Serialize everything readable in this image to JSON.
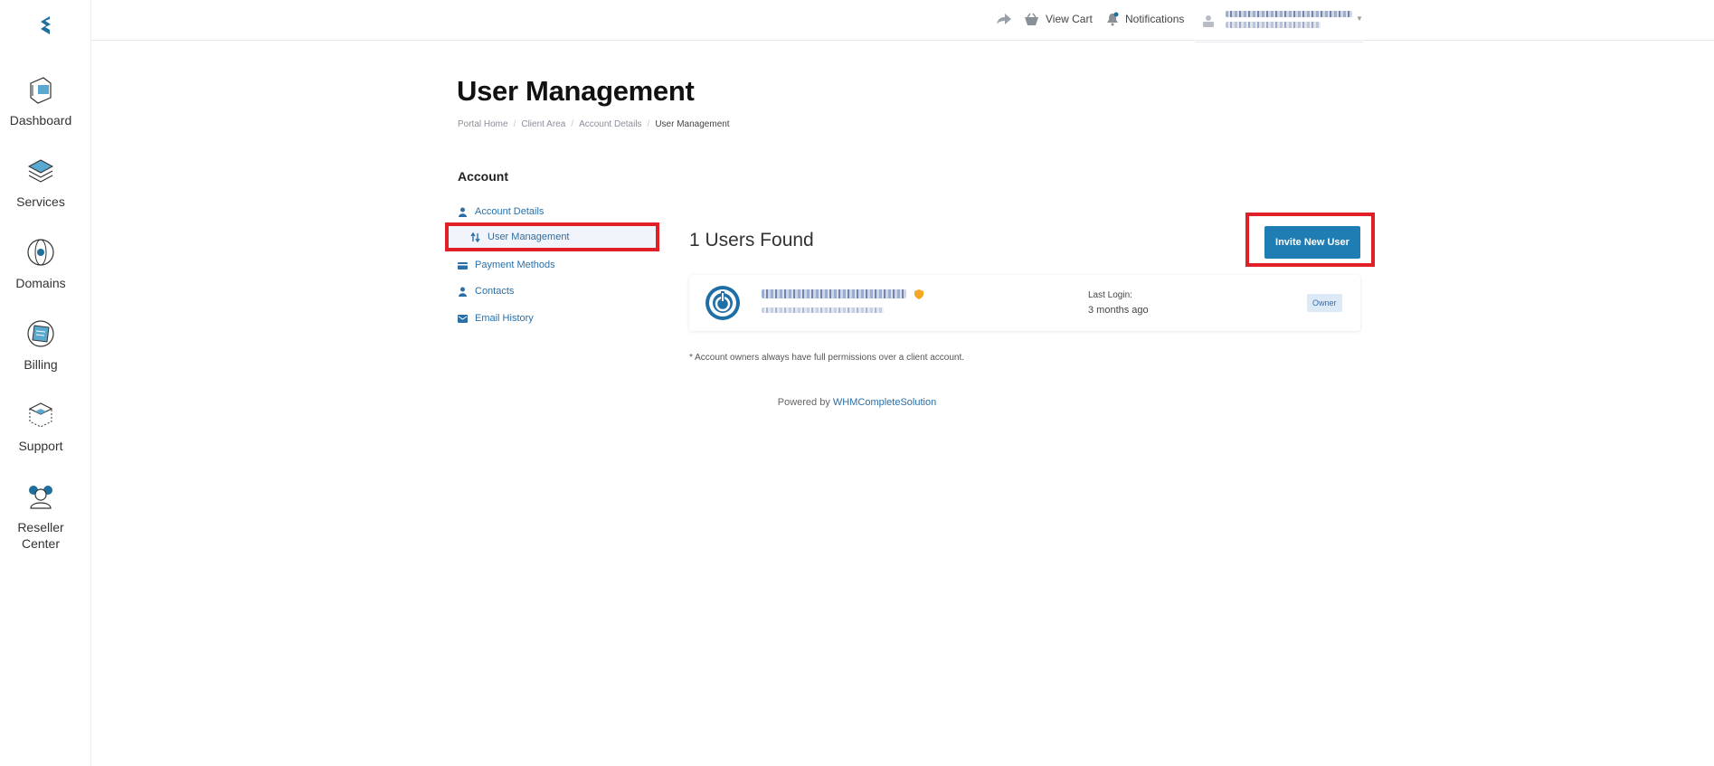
{
  "sidebar": {
    "items": [
      {
        "label": "Dashboard"
      },
      {
        "label": "Services"
      },
      {
        "label": "Domains"
      },
      {
        "label": "Billing"
      },
      {
        "label": "Support"
      },
      {
        "label": "Reseller\nCenter"
      }
    ]
  },
  "topbar": {
    "view_cart": "View Cart",
    "notifications": "Notifications"
  },
  "page": {
    "title": "User Management",
    "breadcrumb": [
      "Portal Home",
      "Client Area",
      "Account Details",
      "User Management"
    ]
  },
  "account_menu": {
    "heading": "Account",
    "items": [
      {
        "label": "Account Details"
      },
      {
        "label": "User Management"
      },
      {
        "label": "Payment Methods"
      },
      {
        "label": "Contacts"
      },
      {
        "label": "Email History"
      }
    ]
  },
  "users": {
    "count_text": "1 Users Found",
    "invite_label": "Invite New User",
    "list": [
      {
        "last_login_label": "Last Login:",
        "last_login_value": "3 months ago",
        "role": "Owner"
      }
    ],
    "note": "* Account owners always have full permissions over a client account."
  },
  "footer": {
    "powered_prefix": "Powered by",
    "powered_link": "WHMCompleteSolution"
  },
  "colors": {
    "accent": "#1f7db3",
    "highlight": "#e01f26",
    "link": "#2a6fa7"
  }
}
